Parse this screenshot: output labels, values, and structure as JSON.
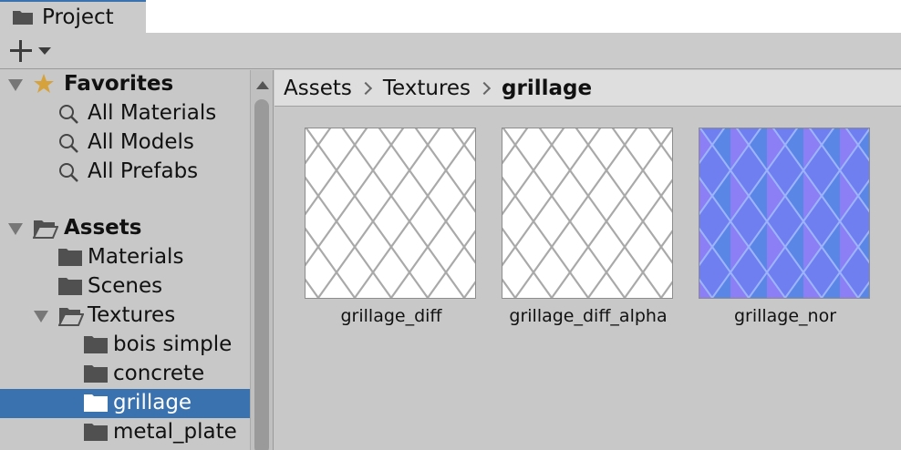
{
  "window": {
    "tab_label": "Project"
  },
  "toolbar": {
    "add_icon": "plus-icon",
    "dropdown_icon": "caret-down-icon"
  },
  "sidebar": {
    "favorites": {
      "label": "Favorites",
      "items": [
        "All Materials",
        "All Models",
        "All Prefabs"
      ]
    },
    "assets": {
      "label": "Assets",
      "items": [
        {
          "label": "Materials"
        },
        {
          "label": "Scenes"
        },
        {
          "label": "Textures",
          "children": [
            "bois simple",
            "concrete",
            "grillage",
            "metal_plate"
          ]
        }
      ]
    },
    "selected": "grillage"
  },
  "breadcrumb": [
    "Assets",
    "Textures",
    "grillage"
  ],
  "assets_grid": [
    {
      "name": "grillage_diff",
      "type": "diffuse"
    },
    {
      "name": "grillage_diff_alpha",
      "type": "diffuse"
    },
    {
      "name": "grillage_nor",
      "type": "normal"
    }
  ],
  "colors": {
    "selection": "#3a72b0",
    "star": "#d6a23c",
    "normal_map": "#6f7ff0"
  }
}
